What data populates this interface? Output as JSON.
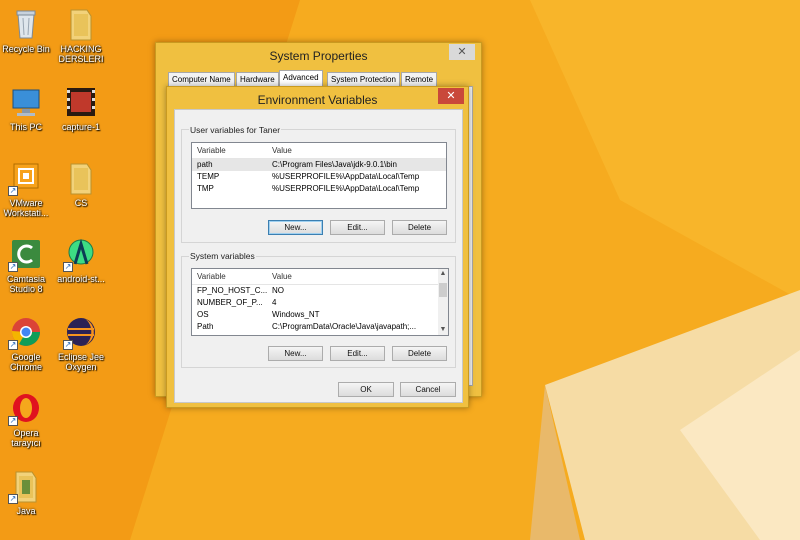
{
  "desktop": {
    "icons": [
      {
        "label": "Recycle Bin",
        "icon": "recycle-bin-icon"
      },
      {
        "label": "HACKING DERSLERI",
        "icon": "folder-icon"
      },
      {
        "label": "This PC",
        "icon": "computer-icon"
      },
      {
        "label": "capture-1",
        "icon": "video-file-icon"
      },
      {
        "label": "VMware Workstati...",
        "icon": "vmware-icon"
      },
      {
        "label": "CS",
        "icon": "folder-icon"
      },
      {
        "label": "Camtasia Studio 8",
        "icon": "camtasia-icon"
      },
      {
        "label": "android-st...",
        "icon": "android-studio-icon"
      },
      {
        "label": "Google Chrome",
        "icon": "chrome-icon"
      },
      {
        "label": "Eclipse Jee Oxygen",
        "icon": "eclipse-icon"
      },
      {
        "label": "Opera tarayıcı",
        "icon": "opera-icon"
      },
      {
        "label": "Java",
        "icon": "folder-icon"
      }
    ]
  },
  "system_properties": {
    "title": "System Properties",
    "close": "✕",
    "tabs": [
      "Computer Name",
      "Hardware",
      "Advanced",
      "System Protection",
      "Remote"
    ],
    "active_tab": "Advanced"
  },
  "env_vars": {
    "title": "Environment Variables",
    "close": "✕",
    "user_group_label": "User variables for Taner",
    "system_group_label": "System variables",
    "col_variable": "Variable",
    "col_value": "Value",
    "user_rows": [
      {
        "variable": "path",
        "value": "C:\\Program Files\\Java\\jdk-9.0.1\\bin"
      },
      {
        "variable": "TEMP",
        "value": "%USERPROFILE%\\AppData\\Local\\Temp"
      },
      {
        "variable": "TMP",
        "value": "%USERPROFILE%\\AppData\\Local\\Temp"
      }
    ],
    "system_rows": [
      {
        "variable": "FP_NO_HOST_C...",
        "value": "NO"
      },
      {
        "variable": "NUMBER_OF_P...",
        "value": "4"
      },
      {
        "variable": "OS",
        "value": "Windows_NT"
      },
      {
        "variable": "Path",
        "value": "C:\\ProgramData\\Oracle\\Java\\javapath;..."
      }
    ],
    "btn_new": "New...",
    "btn_edit": "Edit...",
    "btn_delete": "Delete",
    "btn_ok": "OK",
    "btn_cancel": "Cancel"
  },
  "colors": {
    "desktop_orange": "#f5a81c",
    "window_frame": "#f0c040",
    "close_red": "#c9483a"
  }
}
